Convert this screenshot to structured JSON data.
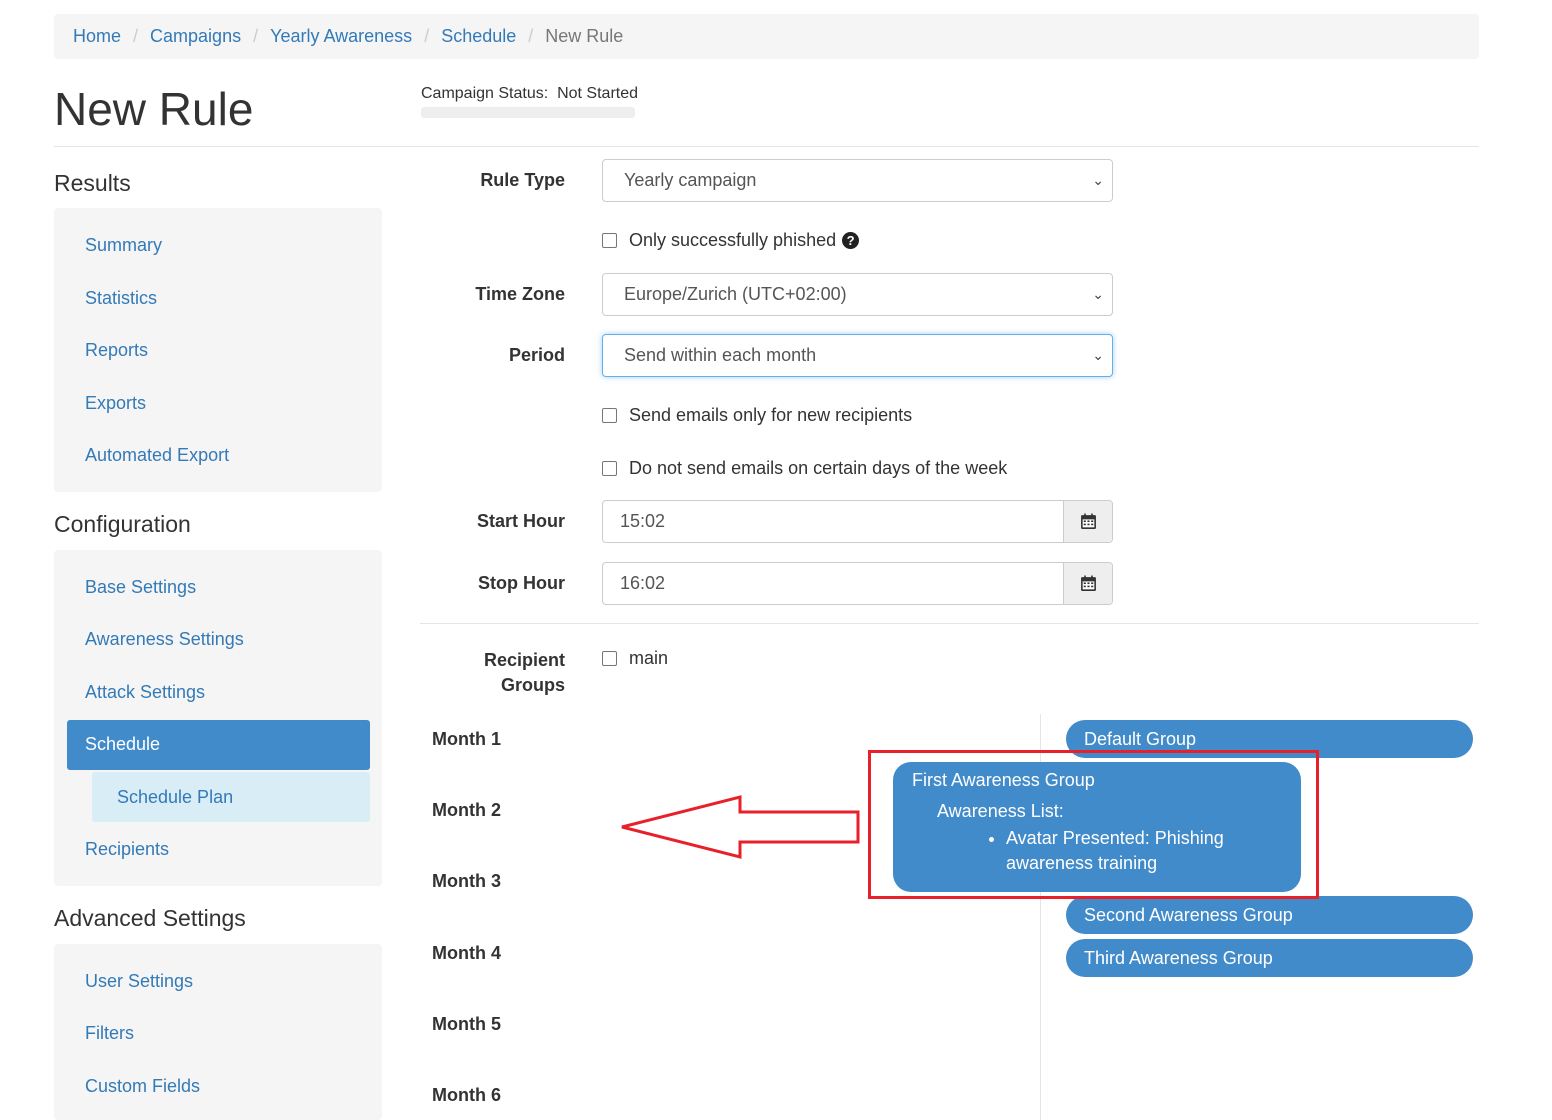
{
  "breadcrumb": {
    "items": [
      "Home",
      "Campaigns",
      "Yearly Awareness",
      "Schedule"
    ],
    "active": "New Rule",
    "separator": "/"
  },
  "page": {
    "title": "New Rule",
    "status_label": "Campaign Status:",
    "status_value": "Not Started"
  },
  "sidebar": {
    "results_title": "Results",
    "results": [
      "Summary",
      "Statistics",
      "Reports",
      "Exports",
      "Automated Export"
    ],
    "configuration_title": "Configuration",
    "configuration": [
      "Base Settings",
      "Awareness Settings",
      "Attack Settings"
    ],
    "active_item": "Schedule",
    "sub_item": "Schedule Plan",
    "recipients": "Recipients",
    "advanced_title": "Advanced Settings",
    "advanced": [
      "User Settings",
      "Filters",
      "Custom Fields"
    ]
  },
  "form": {
    "rule_type_label": "Rule Type",
    "rule_type_value": "Yearly campaign",
    "only_phished_label": "Only successfully phished",
    "help_icon": "question-circle-icon",
    "time_zone_label": "Time Zone",
    "time_zone_value": "Europe/Zurich (UTC+02:00)",
    "period_label": "Period",
    "period_value": "Send within each month",
    "new_recipients_label": "Send emails only for new recipients",
    "certain_days_label": "Do not send emails on certain days of the week",
    "start_hour_label": "Start Hour",
    "start_hour_value": "15:02",
    "stop_hour_label": "Stop Hour",
    "stop_hour_value": "16:02",
    "recipient_groups_label_1": "Recipient",
    "recipient_groups_label_2": "Groups",
    "recipient_group_main": "main"
  },
  "schedule": {
    "months": [
      "Month 1",
      "Month 2",
      "Month 3",
      "Month 4",
      "Month 5",
      "Month 6"
    ],
    "groups": {
      "default": "Default Group",
      "first": "First Awareness Group",
      "first_list_title": "Awareness List:",
      "first_list_item": "Avatar Presented: Phishing awareness training",
      "second": "Second Awareness Group",
      "third": "Third Awareness Group"
    }
  },
  "colors": {
    "link": "#337ab7",
    "primary": "#428bca",
    "highlight_box": "#e8202a"
  }
}
